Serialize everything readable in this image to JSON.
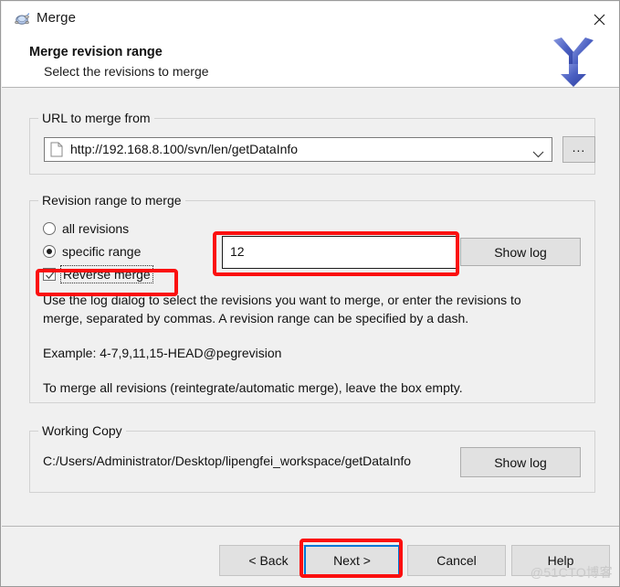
{
  "window": {
    "title": "Merge",
    "icon": "tortoisesvn-turtle-icon",
    "close_label": "✕"
  },
  "header": {
    "title": "Merge revision range",
    "subtitle": "Select the revisions to merge",
    "graphic": "merge-arrow-icon"
  },
  "url_group": {
    "label": "URL to merge from",
    "combo_value": "http://192.168.8.100/svn/len/getDataInfo",
    "combo_icon": "document-icon",
    "dropdown_icon": "chevron-down-icon",
    "browse_label": "..."
  },
  "revision_group": {
    "label": "Revision range to merge",
    "options": [
      {
        "label": "all revisions",
        "selected": false
      },
      {
        "label": "specific range",
        "selected": true
      }
    ],
    "reverse_merge": {
      "label": "Reverse merge",
      "checked": true
    },
    "revision_value": "12",
    "show_log_label": "Show log",
    "help": [
      "Use the log dialog to select the revisions you want to merge, or enter the revisions to",
      "merge, separated by commas. A revision range can be specified by a dash.",
      "Example: 4-7,9,11,15-HEAD@pegrevision",
      "To merge all revisions (reintegrate/automatic merge), leave the box empty."
    ]
  },
  "working_copy_group": {
    "label": "Working Copy",
    "path": "C:/Users/Administrator/Desktop/lipengfei_workspace/getDataInfo",
    "show_log_label": "Show log"
  },
  "footer": {
    "back_label": "< Back",
    "next_label": "Next >",
    "cancel_label": "Cancel",
    "help_label": "Help"
  },
  "watermark": "@51CTO博客",
  "colors": {
    "annotation_red": "#fb0f0f",
    "focus_blue": "#0078d7",
    "dialog_bg": "#f0f0f0",
    "merge_arrow_blue": "#4a5fc1"
  }
}
